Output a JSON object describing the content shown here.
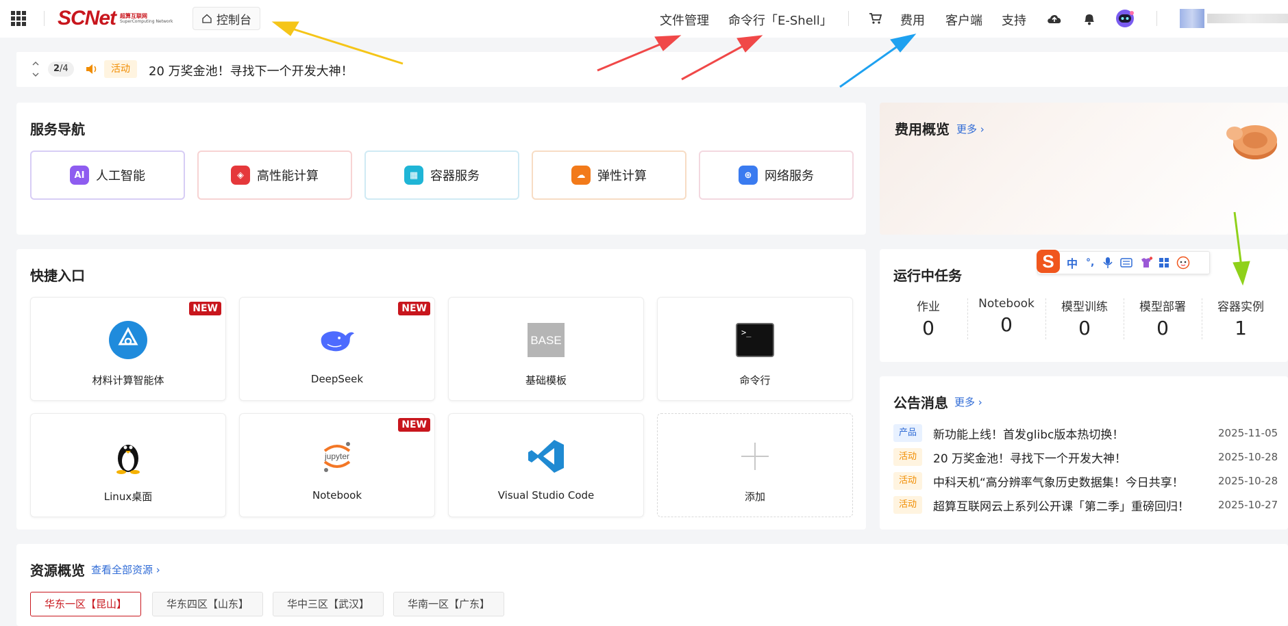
{
  "header": {
    "logo_text": "SCNet",
    "logo_cn": "超算互联网",
    "logo_en": "SuperComputing Network",
    "console_label": "控制台",
    "nav": {
      "file_mgmt": "文件管理",
      "eshell": "命令行「E-Shell」",
      "billing": "费用",
      "client": "客户端",
      "support": "支持"
    },
    "icons": [
      "apps-grid-icon",
      "home-icon",
      "cart-icon",
      "cloud-upload-icon",
      "bell-icon",
      "robot-avatar-icon",
      "user-avatar"
    ]
  },
  "notice_bar": {
    "pager_current": "2",
    "pager_total": "/4",
    "tag": "活动",
    "text": "20 万奖金池！寻找下一个开发大神！"
  },
  "service_nav": {
    "title": "服务导航",
    "items": [
      {
        "label": "人工智能",
        "icon": "ai-icon",
        "color": "#8e5cf0",
        "border": "#d7cdf5"
      },
      {
        "label": "高性能计算",
        "icon": "hpc-icon",
        "color": "#e5383b",
        "border": "#f7d3d3"
      },
      {
        "label": "容器服务",
        "icon": "docker-icon",
        "color": "#1fb5d6",
        "border": "#cfeaf4"
      },
      {
        "label": "弹性计算",
        "icon": "elastic-icon",
        "color": "#f27a1a",
        "border": "#f7dcc4"
      },
      {
        "label": "网络服务",
        "icon": "globe-icon",
        "color": "#3a7bf0",
        "border": "#f3d8e0"
      }
    ]
  },
  "quick_entry": {
    "title": "快捷入口",
    "new_badge": "NEW",
    "items": [
      {
        "label": "材料计算智能体",
        "icon": "material-agent-icon",
        "is_new": true
      },
      {
        "label": "DeepSeek",
        "icon": "deepseek-whale-icon",
        "is_new": true
      },
      {
        "label": "基础模板",
        "icon": "base-template-icon",
        "icon_text": "BASE",
        "is_new": false
      },
      {
        "label": "命令行",
        "icon": "terminal-icon",
        "icon_text": ">_",
        "is_new": false
      },
      {
        "label": "Linux桌面",
        "icon": "linux-penguin-icon",
        "is_new": false
      },
      {
        "label": "Notebook",
        "icon": "jupyter-icon",
        "icon_text": "jupyter",
        "is_new": true
      },
      {
        "label": "Visual Studio Code",
        "icon": "vscode-icon",
        "is_new": false
      },
      {
        "label": "添加",
        "icon": "plus-icon",
        "is_new": false
      }
    ]
  },
  "billing_overview": {
    "title": "费用概览",
    "more": "更多"
  },
  "running_tasks": {
    "title": "运行中任务",
    "items": [
      {
        "label": "作业",
        "value": "0"
      },
      {
        "label": "Notebook",
        "value": "0"
      },
      {
        "label": "模型训练",
        "value": "0"
      },
      {
        "label": "模型部署",
        "value": "0"
      },
      {
        "label": "容器实例",
        "value": "1"
      }
    ]
  },
  "ime_toolbar": {
    "items": [
      "中",
      "°,"
    ]
  },
  "announcements": {
    "title": "公告消息",
    "more": "更多",
    "items": [
      {
        "tag": "产品",
        "type": "product",
        "text": "新功能上线！首发glibc版本热切换！",
        "date": "2025-11-05"
      },
      {
        "tag": "活动",
        "type": "activity",
        "text": "20 万奖金池！寻找下一个开发大神！",
        "date": "2025-10-28"
      },
      {
        "tag": "活动",
        "type": "activity",
        "text": "中科天机“高分辨率气象历史数据集！今日共享！",
        "date": "2025-10-28"
      },
      {
        "tag": "活动",
        "type": "activity",
        "text": "超算互联网云上系列公开课「第二季」重磅回归！",
        "date": "2025-10-27"
      }
    ]
  },
  "resources": {
    "title": "资源概览",
    "view_all": "查看全部资源",
    "tabs": [
      "华东一区【昆山】",
      "华东四区【山东】",
      "华中三区【武汉】",
      "华南一区【广东】"
    ]
  },
  "annotation_colors": {
    "yellow_arrow": "#f5c518",
    "red_arrow": "#f04848",
    "blue_arrow": "#1ea1f0",
    "green_arrow": "#8fd11a"
  }
}
